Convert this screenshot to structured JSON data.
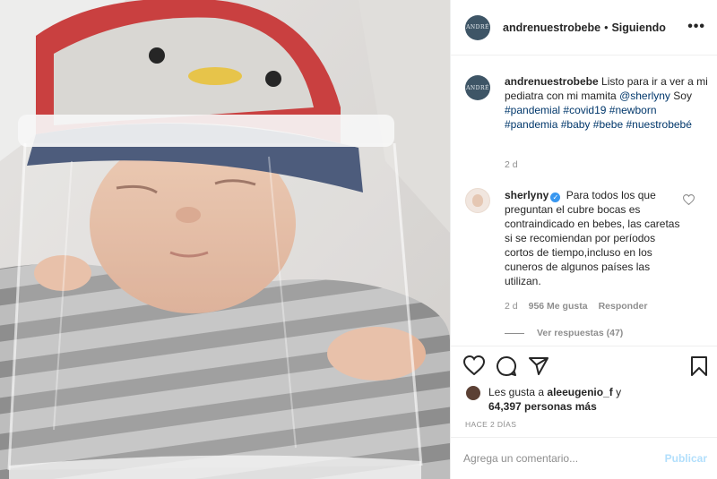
{
  "header": {
    "avatar_text": "ANDRÉ",
    "username": "andrenuestrobebe",
    "separator": "•",
    "following_label": "Siguiendo",
    "more_icon": "ellipsis-icon"
  },
  "caption": {
    "username": "andrenuestrobebe",
    "text_1": "Listo para ir a ver a mi pediatra con mi mamita",
    "mention": "@sherlyny",
    "text_2": "Soy",
    "hashtags": [
      "#pandemial",
      "#covid19",
      "#newborn",
      "#pandemia",
      "#baby",
      "#bebe",
      "#nuestrobebé"
    ],
    "time": "2 d"
  },
  "comment": {
    "username": "sherlyny",
    "verified_icon": "verified-badge-icon",
    "text": "Para todos los que preguntan el cubre bocas es contraindicado en bebes, las caretas si se recomiendan por períodos cortos de tiempo,incluso en los cuneros de algunos países las utilizan.",
    "time": "2 d",
    "likes": "956 Me gusta",
    "reply_label": "Responder",
    "view_replies": "Ver respuestas (47)",
    "like_icon": "heart-icon"
  },
  "actions": {
    "icons": [
      "heart-icon",
      "comment-icon",
      "share-icon",
      "bookmark-icon"
    ],
    "likes_prefix": "Les gusta a",
    "likes_user": "aleeugenio_f",
    "likes_conj": "y",
    "likes_count": "64,397 personas más",
    "posted_ago": "HACE 2 DÍAS"
  },
  "add_comment": {
    "placeholder": "Agrega un comentario...",
    "publish_label": "Publicar"
  },
  "colors": {
    "link": "#00376b",
    "muted": "#8e8e8e",
    "verified": "#3897f0",
    "publish_disabled": "#b2dffc"
  }
}
